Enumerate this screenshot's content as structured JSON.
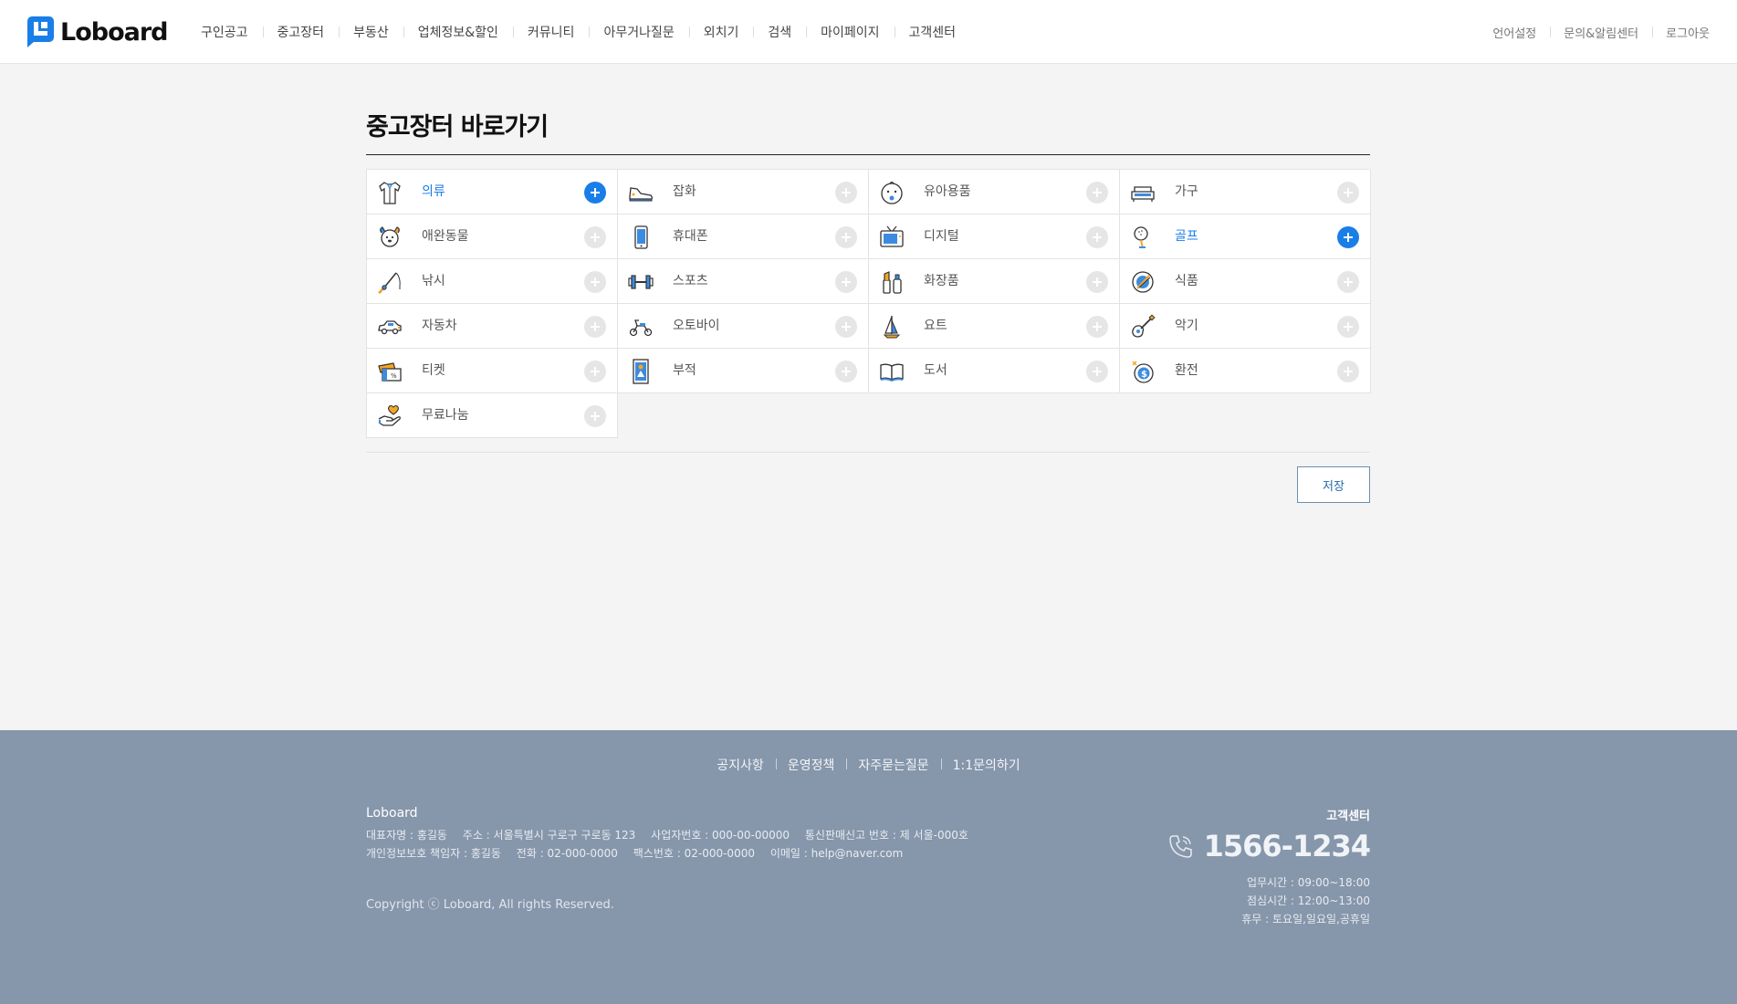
{
  "header": {
    "logo_text": "Loboard",
    "nav": [
      "구인공고",
      "중고장터",
      "부동산",
      "업체정보&할인",
      "커뮤니티",
      "아무거나질문",
      "외치기",
      "검색",
      "마이페이지",
      "고객센터"
    ],
    "util": [
      "언어설정",
      "문의&알림센터",
      "로그아웃"
    ]
  },
  "main": {
    "title": "중고장터 바로가기",
    "categories": [
      {
        "label": "의류",
        "icon": "shirt-icon",
        "active": true
      },
      {
        "label": "잡화",
        "icon": "sneaker-icon",
        "active": false
      },
      {
        "label": "유아용품",
        "icon": "baby-icon",
        "active": false
      },
      {
        "label": "가구",
        "icon": "sofa-icon",
        "active": false
      },
      {
        "label": "애완동물",
        "icon": "dog-icon",
        "active": false
      },
      {
        "label": "휴대폰",
        "icon": "phone-icon",
        "active": false
      },
      {
        "label": "디지털",
        "icon": "tv-icon",
        "active": false
      },
      {
        "label": "골프",
        "icon": "golf-icon",
        "active": true
      },
      {
        "label": "낚시",
        "icon": "fishing-rod-icon",
        "active": false
      },
      {
        "label": "스포츠",
        "icon": "dumbbell-icon",
        "active": false
      },
      {
        "label": "화장품",
        "icon": "cosmetics-icon",
        "active": false
      },
      {
        "label": "식품",
        "icon": "food-icon",
        "active": false
      },
      {
        "label": "자동차",
        "icon": "car-icon",
        "active": false
      },
      {
        "label": "오토바이",
        "icon": "scooter-icon",
        "active": false
      },
      {
        "label": "요트",
        "icon": "sailboat-icon",
        "active": false
      },
      {
        "label": "악기",
        "icon": "guitar-icon",
        "active": false
      },
      {
        "label": "티켓",
        "icon": "ticket-icon",
        "active": false
      },
      {
        "label": "부적",
        "icon": "talisman-icon",
        "active": false
      },
      {
        "label": "도서",
        "icon": "book-icon",
        "active": false
      },
      {
        "label": "환전",
        "icon": "money-bag-icon",
        "active": false
      },
      {
        "label": "무료나눔",
        "icon": "hand-heart-icon",
        "active": false
      }
    ],
    "save_label": "저장"
  },
  "footer": {
    "links": [
      "공지사항",
      "운영정책",
      "자주묻는질문",
      "1:1문의하기"
    ],
    "company_name": "Loboard",
    "line1": [
      "대표자명 : 홍길동",
      "주소 : 서울특별시 구로구 구로동 123",
      "사업자번호 : 000-00-00000",
      "통신판매신고 번호 : 제 서울-000호"
    ],
    "line2": [
      "개인정보보호 책임자 : 홍길동",
      "전화 : 02-000-0000",
      "팩스번호 : 02-000-0000",
      "이메일 : help@naver.com"
    ],
    "copyright": "Copyright ⓒ Loboard, All rights Reserved.",
    "cs_title": "고객센터",
    "cs_phone": "1566-1234",
    "cs_hours": [
      "업무시간 : 09:00~18:00",
      "점심시간 : 12:00~13:00",
      "휴무 : 토요일,일요일,공휴일"
    ]
  },
  "colors": {
    "accent": "#1a7ee8",
    "footer_bg": "#8696ab",
    "icon_orange": "#f5a623",
    "icon_blue": "#3d8be0"
  }
}
